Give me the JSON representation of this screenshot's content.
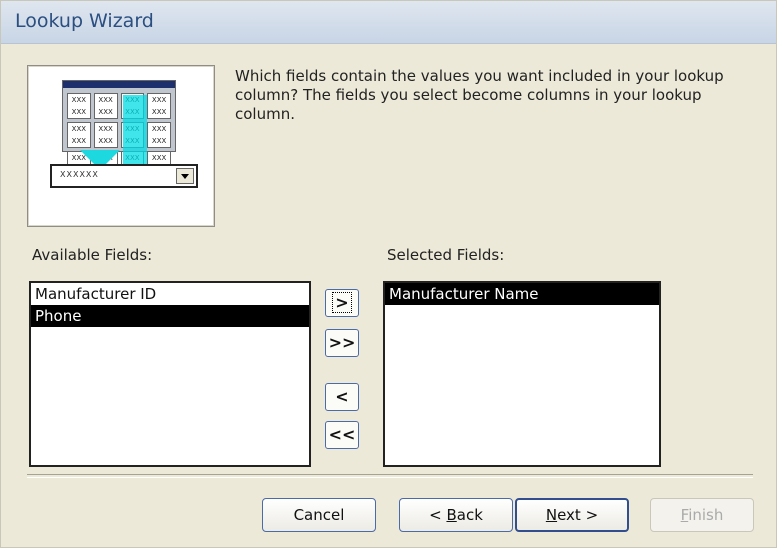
{
  "window": {
    "title": "Lookup Wizard"
  },
  "illustration": {
    "cell_text": "XXX XXX",
    "combo_text": "XXXXXX"
  },
  "instructions": "Which fields contain the values you want included in your lookup column? The fields you select become columns in your lookup column.",
  "available": {
    "label": "Available Fields:",
    "items": [
      {
        "text": "Manufacturer ID",
        "selected": false
      },
      {
        "text": "Phone",
        "selected": true
      }
    ]
  },
  "selected": {
    "label": "Selected Fields:",
    "items": [
      {
        "text": "Manufacturer Name",
        "selected": true
      }
    ]
  },
  "move_buttons": {
    "add_one": ">",
    "add_all": ">>",
    "remove_one": "<",
    "remove_all": "<<"
  },
  "footer": {
    "cancel": "Cancel",
    "back_prefix": "< ",
    "back_accel": "B",
    "back_rest": "ack",
    "next_accel": "N",
    "next_rest": "ext >",
    "finish_accel": "F",
    "finish_rest": "inish"
  }
}
